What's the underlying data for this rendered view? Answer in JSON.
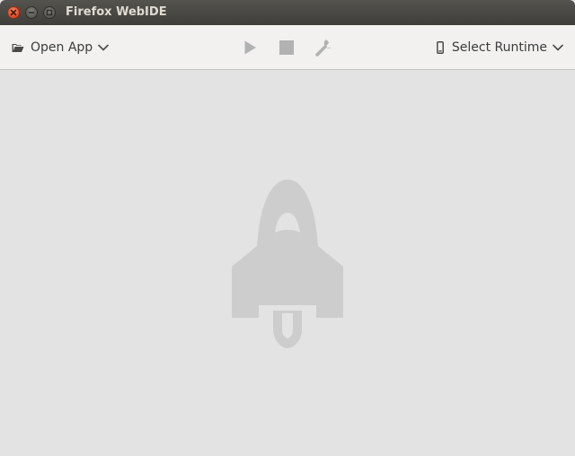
{
  "window": {
    "title": "Firefox WebIDE",
    "controls": [
      "close-icon",
      "minimize-icon",
      "maximize-icon"
    ]
  },
  "toolbar": {
    "open_app": {
      "label": "Open App",
      "icon": "folder-open-icon"
    },
    "actions": [
      {
        "name": "play",
        "icon": "play-icon"
      },
      {
        "name": "stop",
        "icon": "stop-icon"
      },
      {
        "name": "debug",
        "icon": "wrench-icon"
      }
    ],
    "runtime": {
      "label": "Select Runtime",
      "icon": "phone-icon"
    }
  },
  "content": {
    "placeholder_icon": "rocket-icon"
  },
  "colors": {
    "titlebar": "#3f3e3a",
    "title_text": "#dfdbd2",
    "close_button": "#e2532b",
    "toolbar": "#f2f1f0",
    "content_bg": "#e3e3e3",
    "disabled_tool": "#b2b2b2",
    "rocket": "#cdcdcd"
  }
}
